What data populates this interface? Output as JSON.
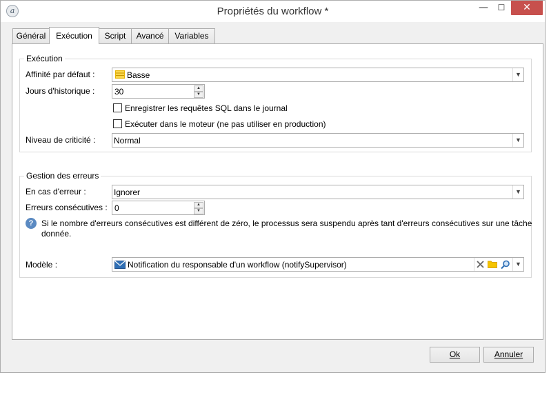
{
  "window": {
    "title": "Propriétés du workflow *",
    "controls": {
      "minimize": "—",
      "maximize": "☐",
      "close": "✕"
    }
  },
  "tabs": [
    {
      "label": "Général"
    },
    {
      "label": "Exécution",
      "active": true
    },
    {
      "label": "Script"
    },
    {
      "label": "Avancé"
    },
    {
      "label": "Variables"
    }
  ],
  "execution": {
    "legend": "Exécution",
    "affinity_label": "Affinité par défaut :",
    "affinity_value": "Basse",
    "history_label": "Jours d'historique :",
    "history_value": "30",
    "sql_log_label": "Enregistrer les requêtes SQL dans le journal",
    "sql_log_checked": false,
    "engine_label": "Exécuter dans le moteur (ne pas utiliser en production)",
    "engine_checked": false,
    "criticality_label": "Niveau de criticité :",
    "criticality_value": "Normal"
  },
  "errors": {
    "legend": "Gestion des erreurs",
    "on_error_label": "En cas d'erreur :",
    "on_error_value": "Ignorer",
    "consecutive_label": "Erreurs consécutives :",
    "consecutive_value": "0",
    "info_text": "Si le nombre d'erreurs consécutives est différent de zéro, le processus sera suspendu après tant d'erreurs consécutives sur une tâche donnée.",
    "model_label": "Modèle :",
    "model_value": "Notification du responsable d'un workflow (notifySupervisor)"
  },
  "buttons": {
    "ok_label": "Ok",
    "cancel_label": "Annuler"
  },
  "colors": {
    "close_button": "#c7504d",
    "help_icon": "#5b8ac2",
    "affinity_icon": "#e8b400",
    "folder_icon": "#e8b400",
    "envelope_icon": "#2f6fb5"
  }
}
